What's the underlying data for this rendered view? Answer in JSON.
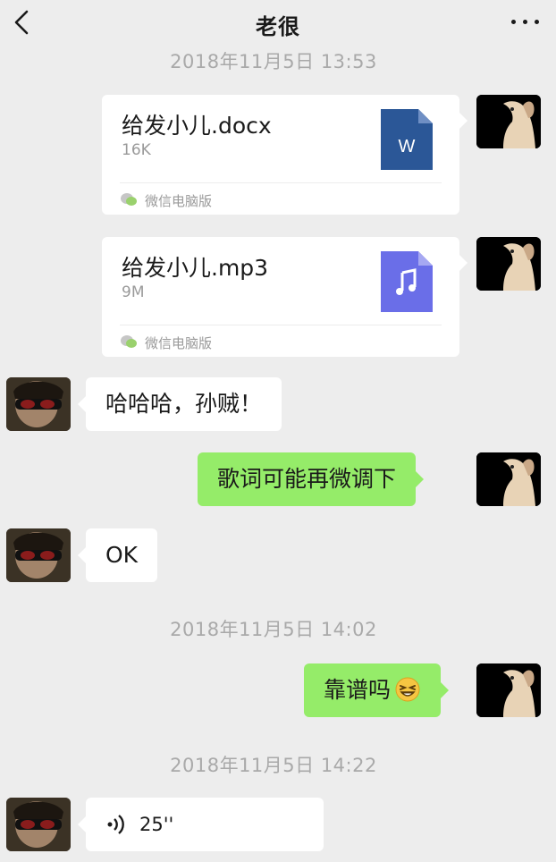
{
  "header": {
    "title": "老很"
  },
  "timestamps": [
    "2018年11月5日 13:53",
    "2018年11月5日 14:02",
    "2018年11月5日 14:22"
  ],
  "files": [
    {
      "name": "给发小儿.docx",
      "size": "16K",
      "source": "微信电脑版",
      "icon": "word-file-icon",
      "color": "#2b5797"
    },
    {
      "name": "给发小儿.mp3",
      "size": "9M",
      "source": "微信电脑版",
      "icon": "music-file-icon",
      "color": "#6a6ee8"
    }
  ],
  "messages": [
    {
      "side": "left",
      "text": "哈哈哈，孙贼！"
    },
    {
      "side": "right",
      "text": "歌词可能再微调下"
    },
    {
      "side": "left",
      "text": "OK"
    },
    {
      "side": "right",
      "text": "靠谱吗",
      "emoji": "grin-emoji"
    }
  ],
  "voice": {
    "side": "left",
    "duration": "25''"
  },
  "colors": {
    "background": "#ededed",
    "self_bubble": "#95ec69",
    "other_bubble": "#ffffff"
  }
}
